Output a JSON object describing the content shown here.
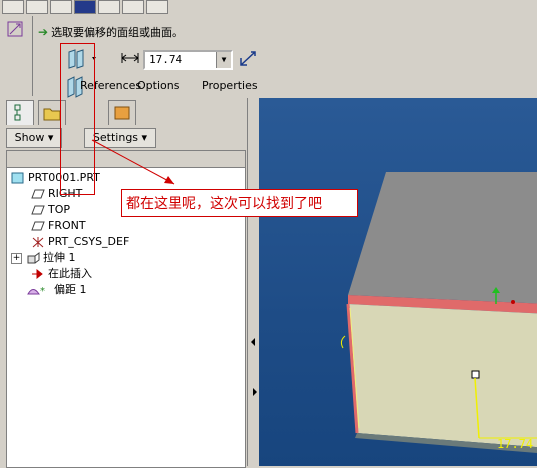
{
  "dashboard": {
    "prompt": "选取要偏移的面组或曲面。",
    "dimension_value": "17.74",
    "tabs": [
      "References",
      "Options",
      "Properties"
    ]
  },
  "navigator": {
    "show_label": "Show",
    "settings_label": "Settings"
  },
  "model_tree": {
    "items": [
      {
        "label": "PRT0001.PRT",
        "icon": "part-icon"
      },
      {
        "label": "RIGHT",
        "icon": "datum-plane-icon"
      },
      {
        "label": "TOP",
        "icon": "datum-plane-icon"
      },
      {
        "label": "FRONT",
        "icon": "datum-plane-icon"
      },
      {
        "label": "PRT_CSYS_DEF",
        "icon": "csys-icon"
      },
      {
        "label": "拉伸 1",
        "icon": "extrude-icon"
      },
      {
        "label": "在此插入",
        "icon": "insert-here-arrow-icon"
      },
      {
        "label": "偏距 1",
        "icon": "offset-feature-icon"
      }
    ]
  },
  "annotation": {
    "callout_text": "都在这里呢，这次可以找到了吧"
  },
  "viewport": {
    "dimension_label": "17.74"
  },
  "colors": {
    "annotation_red": "#d00000",
    "viewport_blue": "#2a5a96",
    "block_top": "#8c8c8c",
    "block_front": "#d8d7b6",
    "block_edge": "#e06a6a"
  }
}
